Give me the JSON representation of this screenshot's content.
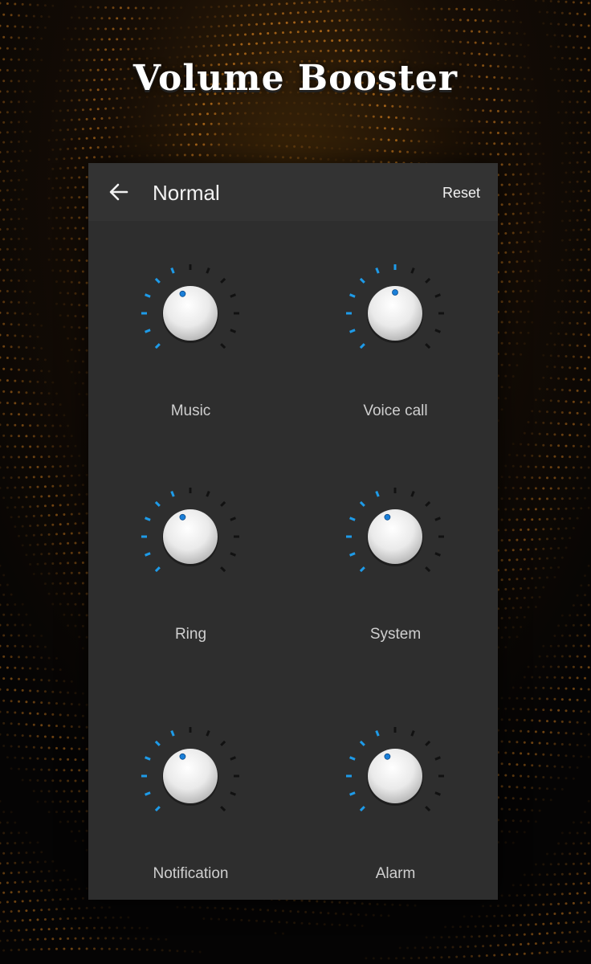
{
  "promo": {
    "title": "Volume Booster"
  },
  "toolbar": {
    "title": "Normal",
    "reset_label": "Reset",
    "back_icon": "arrow-left-icon"
  },
  "colors": {
    "active_tick": "#1e9be8",
    "inactive_tick": "#111111",
    "dot": "#1a7fd8"
  },
  "knobs": [
    {
      "label": "Music",
      "level": 0.42
    },
    {
      "label": "Voice call",
      "level": 0.5
    },
    {
      "label": "Ring",
      "level": 0.42
    },
    {
      "label": "System",
      "level": 0.42
    },
    {
      "label": "Notification",
      "level": 0.42
    },
    {
      "label": "Alarm",
      "level": 0.42
    }
  ]
}
